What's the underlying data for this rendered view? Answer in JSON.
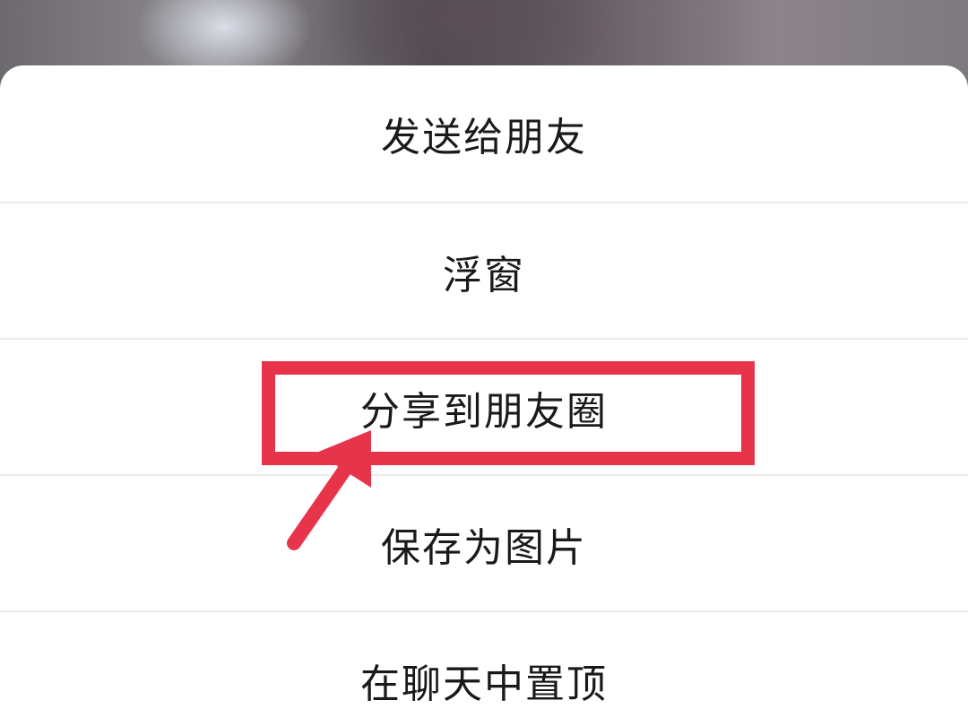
{
  "menu": {
    "items": [
      {
        "label": "发送给朋友"
      },
      {
        "label": "浮窗"
      },
      {
        "label": "分享到朋友圈"
      },
      {
        "label": "保存为图片"
      },
      {
        "label": "在聊天中置顶"
      }
    ]
  },
  "annotation": {
    "color": "#e8344b",
    "highlighted_item": "分享到朋友圈"
  }
}
